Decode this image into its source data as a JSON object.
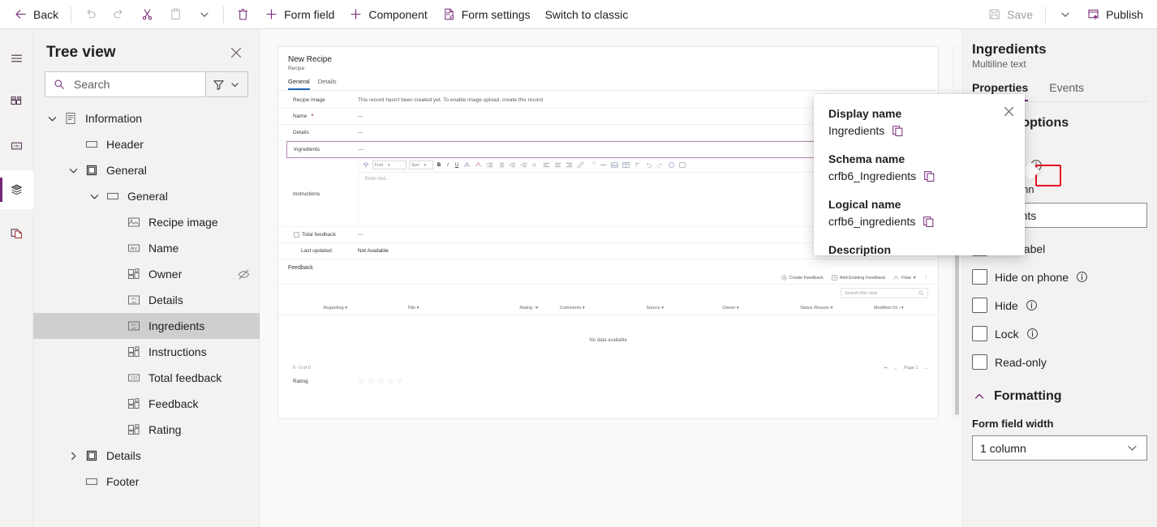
{
  "toolbar": {
    "back": "Back",
    "undo_icon": "undo-icon",
    "redo_icon": "redo-icon",
    "cut_icon": "cut-icon",
    "paste_icon": "paste-icon",
    "paste_chevron_icon": "chevron-down-icon",
    "delete_icon": "delete-icon",
    "form_field": "Form field",
    "component": "Component",
    "form_settings": "Form settings",
    "switch_to_classic": "Switch to classic",
    "save": "Save",
    "save_chevron_icon": "chevron-down-icon",
    "publish": "Publish"
  },
  "rail": {
    "items": [
      {
        "name": "hamburger-menu-icon",
        "label": "Menu"
      },
      {
        "name": "components-icon",
        "label": "Components"
      },
      {
        "name": "text-abc-icon",
        "label": "Table columns"
      },
      {
        "name": "layers-icon",
        "label": "Tree view"
      },
      {
        "name": "pages-copy-icon",
        "label": "Related"
      }
    ]
  },
  "tree": {
    "title": "Tree view",
    "close_icon": "close-icon",
    "search": {
      "placeholder": "Search",
      "value": "",
      "icon": "search-icon"
    },
    "filter_icon": "filter-icon",
    "filter_chevron_icon": "chevron-down-icon",
    "nodes": [
      {
        "label": "Information",
        "indent": 0,
        "chevron": "down",
        "icon": "form-page-icon",
        "selected": false,
        "hidden_icon": false
      },
      {
        "label": "Header",
        "indent": 1,
        "chevron": "none",
        "icon": "section-icon",
        "selected": false,
        "hidden_icon": false
      },
      {
        "label": "General",
        "indent": 1,
        "chevron": "down",
        "icon": "tab-icon",
        "selected": false,
        "hidden_icon": false
      },
      {
        "label": "General",
        "indent": 2,
        "chevron": "down",
        "icon": "section-icon",
        "selected": false,
        "hidden_icon": false
      },
      {
        "label": "Recipe image",
        "indent": 3,
        "chevron": "none",
        "icon": "image-field-icon",
        "selected": false,
        "hidden_icon": false
      },
      {
        "label": "Name",
        "indent": 3,
        "chevron": "none",
        "icon": "text-field-icon",
        "selected": false,
        "hidden_icon": false
      },
      {
        "label": "Owner",
        "indent": 3,
        "chevron": "none",
        "icon": "lookup-field-icon",
        "selected": false,
        "hidden_icon": true
      },
      {
        "label": "Details",
        "indent": 3,
        "chevron": "none",
        "icon": "multiline-field-icon",
        "selected": false,
        "hidden_icon": false
      },
      {
        "label": "Ingredients",
        "indent": 3,
        "chevron": "none",
        "icon": "multiline-field-icon",
        "selected": true,
        "hidden_icon": false
      },
      {
        "label": "Instructions",
        "indent": 3,
        "chevron": "none",
        "icon": "lookup-field-icon",
        "selected": false,
        "hidden_icon": false
      },
      {
        "label": "Total feedback",
        "indent": 3,
        "chevron": "none",
        "icon": "number-field-icon",
        "selected": false,
        "hidden_icon": false
      },
      {
        "label": "Feedback",
        "indent": 3,
        "chevron": "none",
        "icon": "lookup-field-icon",
        "selected": false,
        "hidden_icon": false
      },
      {
        "label": "Rating",
        "indent": 3,
        "chevron": "none",
        "icon": "lookup-field-icon",
        "selected": false,
        "hidden_icon": false
      },
      {
        "label": "Details",
        "indent": 1,
        "chevron": "right",
        "icon": "tab-icon",
        "selected": false,
        "hidden_icon": false
      },
      {
        "label": "Footer",
        "indent": 1,
        "chevron": "none",
        "icon": "section-icon",
        "selected": false,
        "hidden_icon": false
      }
    ]
  },
  "form_preview": {
    "record_title": "New Recipe",
    "entity_name": "Recipe",
    "tabs": [
      {
        "label": "General",
        "active": true
      },
      {
        "label": "Details",
        "active": false
      }
    ],
    "rows": [
      {
        "label": "Recipe image",
        "value": "This record hasn't been created yet. To enable image upload, create this record",
        "required": false,
        "selected": false
      },
      {
        "label": "Name",
        "value": "---",
        "required": true,
        "selected": false
      },
      {
        "label": "Details",
        "value": "---",
        "required": false,
        "selected": false
      },
      {
        "label": "Ingredients",
        "value": "---",
        "required": false,
        "selected": true
      },
      {
        "label": "Instructions",
        "value": "",
        "required": false,
        "selected": false
      }
    ],
    "rte": {
      "font_placeholder": "Font",
      "size_placeholder": "Size",
      "bold": "B",
      "italic": "I",
      "underline": "U",
      "text_placeholder": "Enter text...",
      "icons": [
        "format-painter-icon",
        "font-color-icon",
        "highlight-color-icon",
        "bullet-list-icon",
        "numbered-list-icon",
        "decrease-indent-icon",
        "increase-indent-icon",
        "blockquote-icon",
        "align-left-icon",
        "align-center-icon",
        "align-right-icon",
        "link-icon",
        "unlink-icon",
        "horizontal-rule-icon",
        "image-icon",
        "table-icon",
        "remove-format-icon",
        "undo-icon",
        "redo-icon",
        "emoji-icon",
        "more-icon"
      ]
    },
    "total_feedback": {
      "label": "Total feedback",
      "value": "---"
    },
    "last_updated": {
      "label": "Last updated:",
      "value": "Not Available"
    },
    "subgrid": {
      "title": "Feedback",
      "commands": [
        {
          "label": "Create Feedback",
          "icon": "add-circle-icon"
        },
        {
          "label": "Add Existing Feedback",
          "icon": "add-existing-icon"
        },
        {
          "label": "Flow",
          "icon": "flow-icon"
        },
        {
          "label": "",
          "icon": "overflow-menu-icon"
        }
      ],
      "search_placeholder": "Search this view",
      "search_icon": "search-icon",
      "columns": [
        "Regarding",
        "Title",
        "Rating",
        "Comments",
        "Source",
        "Owner",
        "Status Reason",
        "Modified On"
      ],
      "sorted_column": "Modified On",
      "empty_message": "No data available",
      "record_count": "0 - 0 of 0",
      "pager": {
        "first_icon": "page-first-icon",
        "prev_icon": "page-prev-icon",
        "label": "Page 1",
        "next_icon": "page-next-icon"
      }
    },
    "rating": {
      "label": "Rating",
      "stars": 5,
      "filled": 0
    }
  },
  "properties": {
    "title": "Ingredients",
    "subtitle": "Multiline text",
    "tabs": [
      {
        "label": "Properties",
        "active": true
      },
      {
        "label": "Events",
        "active": false
      }
    ],
    "section_heading": "Display options",
    "column_label": "Column",
    "column_value": "Ingredients",
    "info_icon": "info-icon",
    "table_column_label": "Table column",
    "label_field_value": "Ingredients",
    "checkboxes": [
      {
        "label": "Hide label",
        "checked": false,
        "info": false
      },
      {
        "label": "Hide on phone",
        "checked": false,
        "info": true
      },
      {
        "label": "Hide",
        "checked": false,
        "info": true
      },
      {
        "label": "Lock",
        "checked": false,
        "info": true
      },
      {
        "label": "Read-only",
        "checked": false,
        "info": false
      }
    ],
    "formatting": {
      "heading": "Formatting",
      "collapse_icon": "chevron-up-icon",
      "field_width_label": "Form field width",
      "field_width_value": "1 column",
      "chevron_icon": "chevron-down-icon"
    }
  },
  "callout": {
    "close_icon": "close-icon",
    "copy_icon": "copy-icon",
    "fields": [
      {
        "heading": "Display name",
        "value": "Ingredients",
        "has_copy": true
      },
      {
        "heading": "Schema name",
        "value": "crfb6_Ingredients",
        "has_copy": true
      },
      {
        "heading": "Logical name",
        "value": "crfb6_ingredients",
        "has_copy": true
      },
      {
        "heading": "Description",
        "value": "",
        "has_copy": false
      }
    ]
  },
  "colors": {
    "accent": "#742774",
    "highlight_box": "#e81123",
    "selection_border": "#b486b4",
    "required": "#a4262c",
    "panel_bg": "#f3f2f1"
  }
}
